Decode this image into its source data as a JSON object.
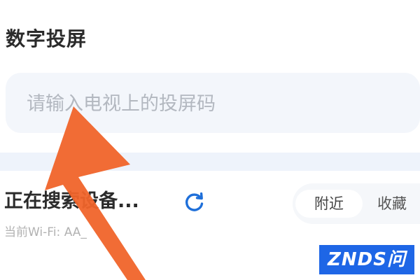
{
  "header": {
    "title": "数字投屏"
  },
  "code_input": {
    "placeholder": "请输入电视上的投屏码",
    "value": ""
  },
  "device_search": {
    "status_text": "正在搜索设备...",
    "refresh_icon": "refresh-icon",
    "wifi_text": "当前Wi-Fi:  AA_"
  },
  "tabs": [
    {
      "label": "附近",
      "selected": true
    },
    {
      "label": "收藏",
      "selected": false
    }
  ],
  "watermark": {
    "text": "ZNDS问答"
  },
  "colors": {
    "accent": "#1e6fd9",
    "arrow": "#f0642a",
    "input_bg": "#f3f6fb",
    "watermark_bg": "#1e66e6"
  }
}
